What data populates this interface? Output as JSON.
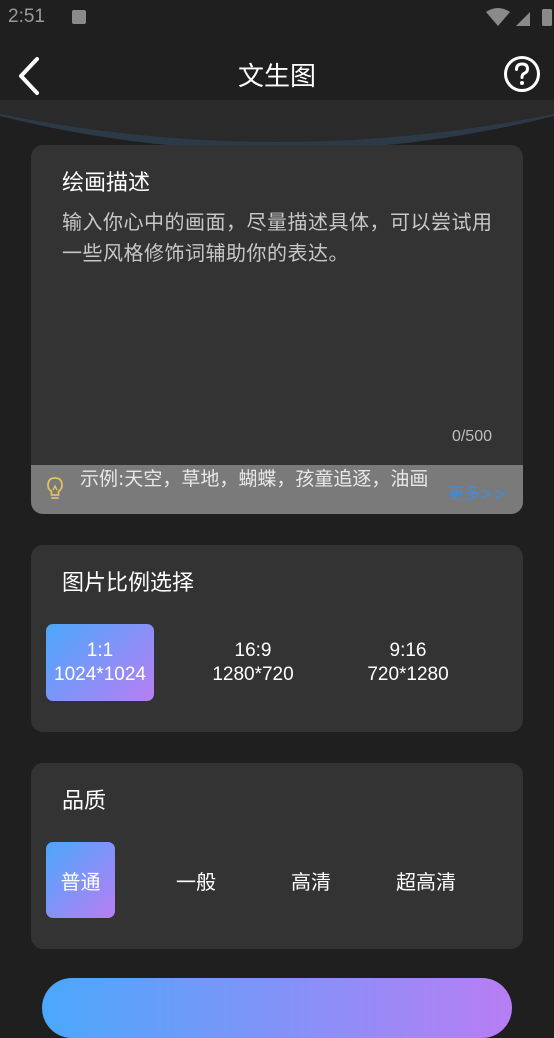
{
  "status": {
    "time": "2:51"
  },
  "appbar": {
    "title": "文生图"
  },
  "description": {
    "title": "绘画描述",
    "placeholder": "输入你心中的画面，尽量描述具体，可以尝试用一些风格修饰词辅助你的表达。",
    "counter": "0/500",
    "example": "示例:天空，草地，蝴蝶，孩童追逐，油画",
    "more": "更多>>"
  },
  "ratio": {
    "title": "图片比例选择",
    "options": [
      {
        "ratio": "1:1",
        "size": "1024*1024",
        "selected": true
      },
      {
        "ratio": "16:9",
        "size": "1280*720",
        "selected": false
      },
      {
        "ratio": "9:16",
        "size": "720*1280",
        "selected": false
      }
    ]
  },
  "quality": {
    "title": "品质",
    "options": [
      {
        "label": "普通",
        "selected": true
      },
      {
        "label": "一般",
        "selected": false
      },
      {
        "label": "高清",
        "selected": false
      },
      {
        "label": "超高清",
        "selected": false
      }
    ]
  },
  "colors": {
    "background": "#1f1f1f",
    "card": "#333333",
    "gradient_start": "#4ba8fb",
    "gradient_end": "#b87ef4",
    "link": "#3d8dde"
  }
}
